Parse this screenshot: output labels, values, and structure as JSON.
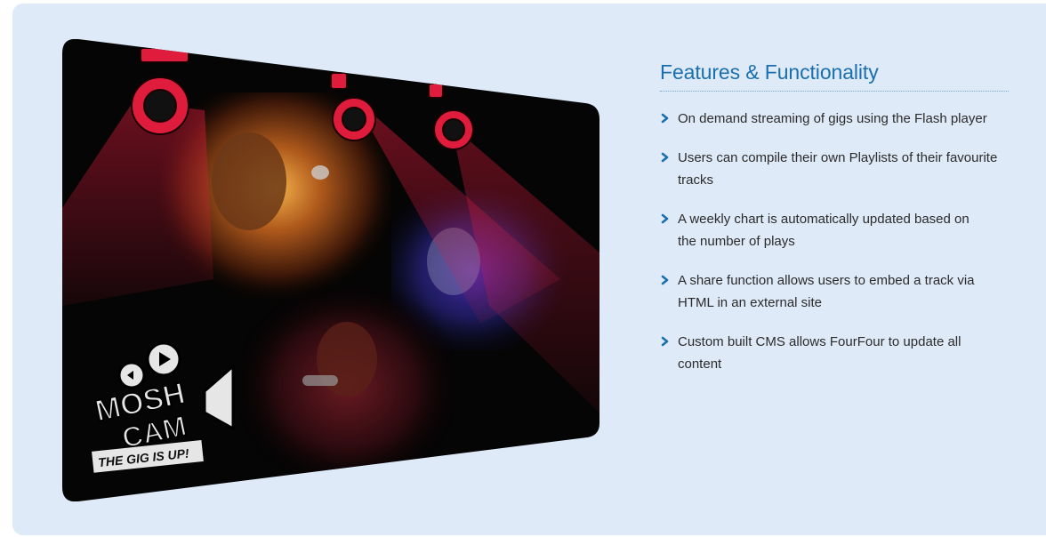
{
  "showcase": {
    "logo_line1": "MOSH",
    "logo_line2": "CAM",
    "tagline": "THE GIG IS UP!"
  },
  "features": {
    "title": "Features & Functionality",
    "items": [
      "On demand streaming of gigs using the Flash player",
      "Users can compile their own Playlists of their favourite tracks",
      "A weekly chart is automatically updated based on the number of plays",
      "A share function allows users to embed a track via HTML in an external site",
      "Custom built CMS allows FourFour to update all content"
    ]
  },
  "colors": {
    "panel_bg": "#dfeaf8",
    "title": "#1a6fae",
    "bullet": "#1a6fae",
    "spotlight": "#e01c3c",
    "text": "#2b2b2b"
  },
  "icons": {
    "bullet": "chevron-right-icon",
    "spotlights": "spotlight-icon",
    "logo": "movie-camera-icon"
  }
}
